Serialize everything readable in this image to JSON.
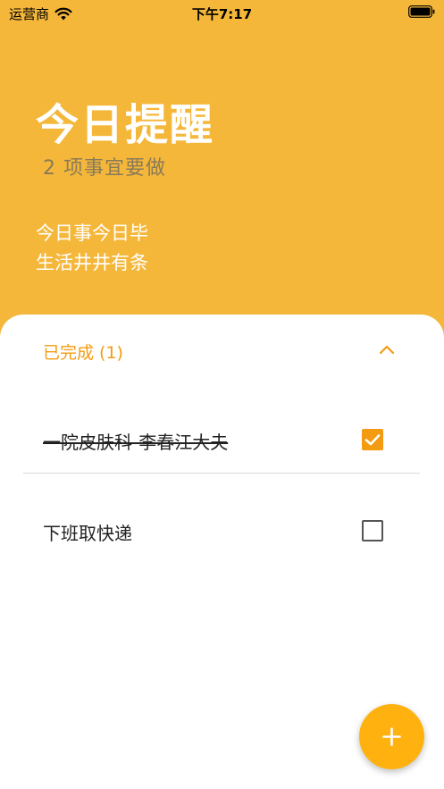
{
  "status_bar": {
    "carrier": "运营商",
    "time": "下午7:17"
  },
  "header": {
    "title": "今日提醒",
    "subtitle": "2 项事宜要做",
    "motto_lines": [
      "今日事今日毕",
      "生活井井有条"
    ]
  },
  "section": {
    "label": "已完成 (1)",
    "expanded": true
  },
  "tasks": [
    {
      "text": "一院皮肤科-李春江大夫",
      "done": true
    },
    {
      "text": "下班取快递",
      "done": false
    }
  ],
  "colors": {
    "header_bg": "#F4B73A",
    "accent": "#F39C12",
    "fab": "#FFB20F"
  },
  "icons": {
    "wifi": "wifi-icon",
    "battery": "battery-icon",
    "chevron": "chevron-up-icon",
    "checkbox_checked": "checkbox-checked-icon",
    "checkbox_unchecked": "checkbox-unchecked-icon",
    "add": "plus-icon"
  }
}
